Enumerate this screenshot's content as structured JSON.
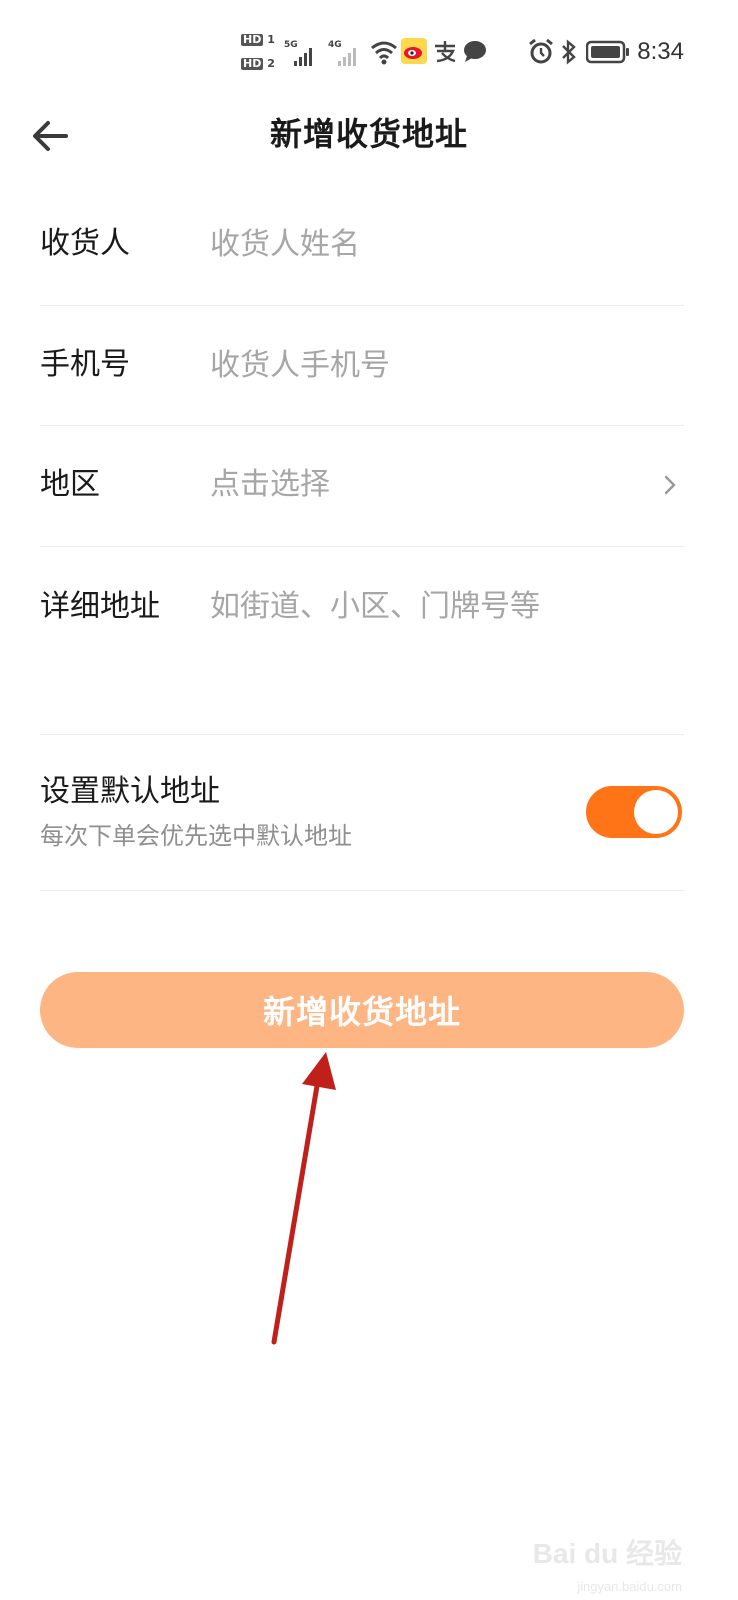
{
  "status_bar": {
    "hd1": "HD",
    "hd1_num": "1",
    "hd2": "HD",
    "hd2_num": "2",
    "network1": "5G",
    "network2": "4G",
    "time": "8:34",
    "icons": [
      "signal-icon",
      "wifi-icon",
      "weibo-icon",
      "alipay-icon",
      "chat-icon",
      "alarm-icon",
      "bluetooth-icon",
      "battery-icon"
    ]
  },
  "header": {
    "title": "新增收货地址",
    "back_icon": "back-arrow-icon"
  },
  "form": {
    "receiver": {
      "label": "收货人",
      "placeholder": "收货人姓名",
      "value": ""
    },
    "phone": {
      "label": "手机号",
      "placeholder": "收货人手机号",
      "value": ""
    },
    "region": {
      "label": "地区",
      "placeholder": "点击选择",
      "value": "",
      "icon": "chevron-right-icon"
    },
    "detail": {
      "label": "详细地址",
      "placeholder": "如街道、小区、门牌号等",
      "value": ""
    }
  },
  "default_address": {
    "title": "设置默认地址",
    "subtitle": "每次下单会优先选中默认地址",
    "enabled": true
  },
  "submit_label": "新增收货地址",
  "watermark": {
    "text": "Bai du 经验",
    "url": "jingyan.baidu.com"
  },
  "colors": {
    "accent": "#ff7417",
    "button": "#fdb584",
    "annotation_arrow": "#c0201a"
  }
}
